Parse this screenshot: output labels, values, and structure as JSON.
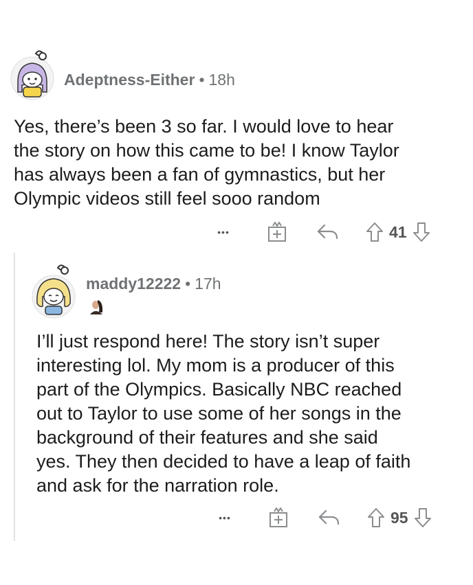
{
  "comments": [
    {
      "username": "Adeptness-Either",
      "separator": "•",
      "time": "18h",
      "lines": [
        "Yes, there’s been 3 so far. I would love to hear",
        "the story on how this came to be! I know Taylor",
        "has always been a fan of gymnastics, but her",
        "Olympic videos still feel sooo random"
      ],
      "votes": "41",
      "more_label": "•••"
    },
    {
      "username": "maddy12222",
      "separator": "•",
      "time": "17h",
      "lines": [
        "I’ll just respond here! The story isn’t super",
        "interesting lol. My mom is a producer of this",
        "part of the Olympics. Basically NBC reached",
        "out to Taylor to use some of her songs in the",
        "background of their features and she said",
        "yes. They then decided to have a leap of faith",
        "and ask for the narration role."
      ],
      "votes": "95",
      "more_label": "•••"
    }
  ],
  "colors": {
    "text": "#1c1c1c",
    "meta": "#6f7274",
    "icon": "#8a8c8e",
    "thread_line": "#e3e3e3"
  }
}
